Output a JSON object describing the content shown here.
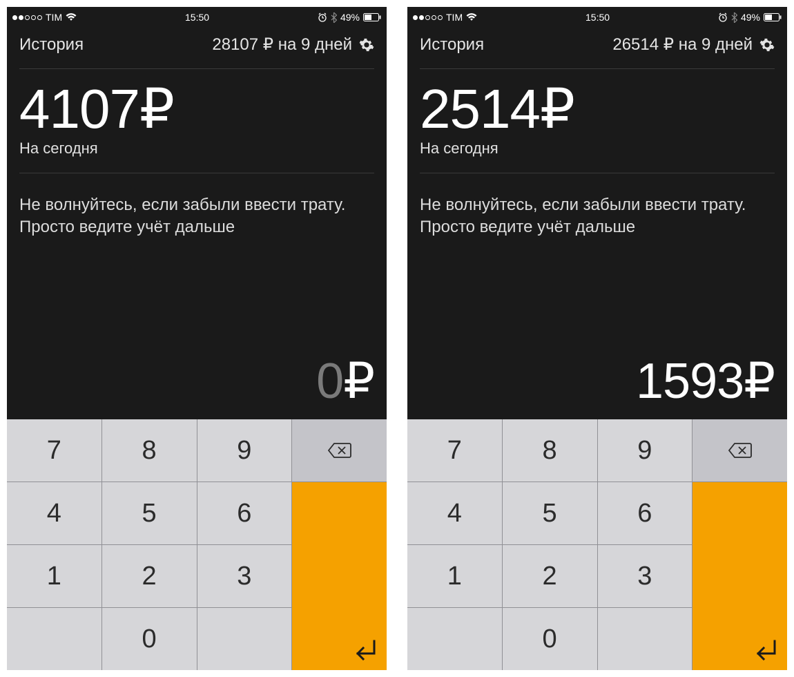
{
  "screens": [
    {
      "status": {
        "carrier": "TIM",
        "time": "15:50",
        "battery": "49%",
        "signal_filled": 2
      },
      "header": {
        "history": "История",
        "summary": "28107 ₽ на 9 дней"
      },
      "main": {
        "amount": "4107₽",
        "amount_label": "На сегодня"
      },
      "tip": "Не волнуйтесь, если забыли ввести трату. Просто ведите учёт дальше",
      "input": {
        "digits": "0",
        "currency": "₽",
        "dim_digits": true
      },
      "keypad": {
        "r0": [
          "7",
          "8",
          "9"
        ],
        "r1": [
          "4",
          "5",
          "6"
        ],
        "r2": [
          "1",
          "2",
          "3"
        ],
        "r3": [
          "",
          "0"
        ],
        "backspace": "⌫",
        "enter": "↵"
      }
    },
    {
      "status": {
        "carrier": "TIM",
        "time": "15:50",
        "battery": "49%",
        "signal_filled": 2
      },
      "header": {
        "history": "История",
        "summary": "26514 ₽ на 9 дней"
      },
      "main": {
        "amount": "2514₽",
        "amount_label": "На сегодня"
      },
      "tip": "Не волнуйтесь, если забыли ввести трату. Просто ведите учёт дальше",
      "input": {
        "digits": "1593",
        "currency": "₽",
        "dim_digits": false
      },
      "keypad": {
        "r0": [
          "7",
          "8",
          "9"
        ],
        "r1": [
          "4",
          "5",
          "6"
        ],
        "r2": [
          "1",
          "2",
          "3"
        ],
        "r3": [
          "",
          "0"
        ],
        "backspace": "⌫",
        "enter": "↵"
      }
    }
  ]
}
